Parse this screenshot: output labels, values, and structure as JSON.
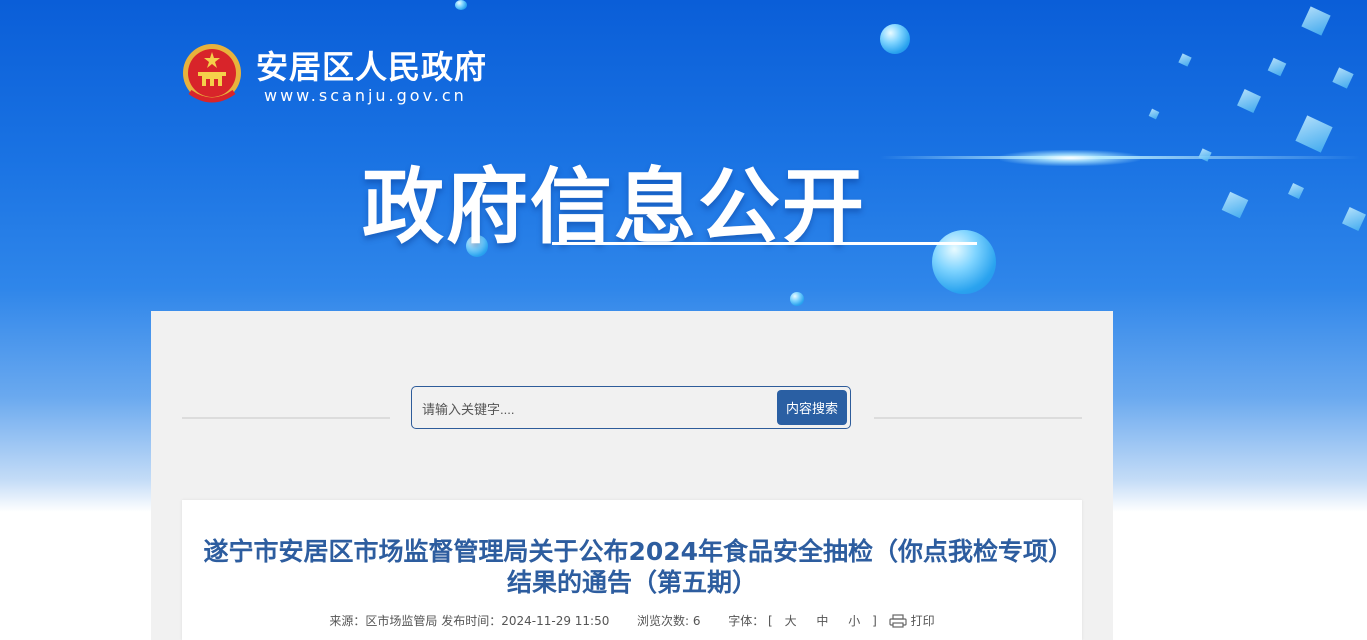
{
  "header": {
    "site_name": "安居区人民政府",
    "site_url": "www.scanju.gov.cn",
    "banner_title": "政府信息公开"
  },
  "search": {
    "placeholder": "请输入关键字....",
    "button_label": "内容搜索"
  },
  "article": {
    "title": "遂宁市安居区市场监督管理局关于公布2024年食品安全抽检（你点我检专项）结果的通告（第五期）",
    "meta": {
      "source_label": "来源：",
      "source_value": "区市场监管局",
      "publish_label": "发布时间：",
      "publish_value": "2024-11-29 11:50",
      "views_label": "浏览次数:",
      "views_value": "6",
      "font_label": "字体：",
      "bracket_open": "[",
      "size_large": "大",
      "size_medium": "中",
      "size_small": "小",
      "bracket_close": "]",
      "print_label": "打印"
    }
  },
  "colors": {
    "banner_blue": "#1a73e3",
    "title_blue": "#2d5d9f",
    "button_blue": "#2a5fa3"
  },
  "icons": {
    "emblem": "national-emblem-icon",
    "print": "printer-icon"
  }
}
